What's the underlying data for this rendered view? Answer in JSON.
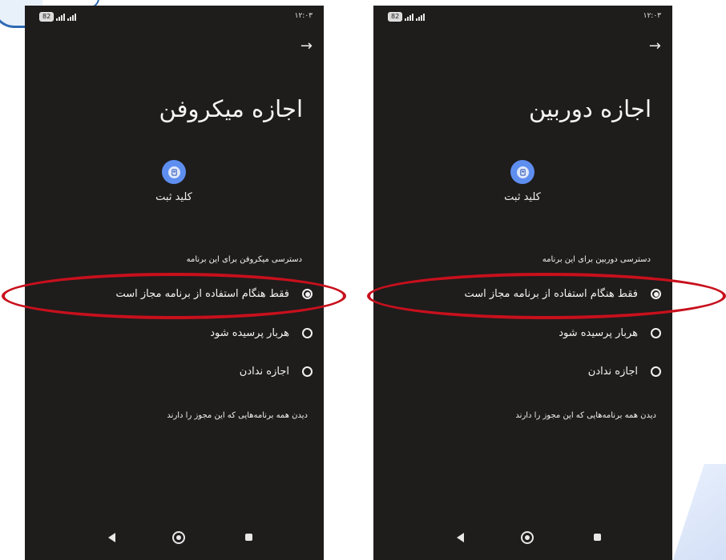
{
  "screens": [
    {
      "statusbar": {
        "battery": "82",
        "time": "۱۲:۰۳"
      },
      "back_arrow": "→",
      "title": "اجازه میکروفن",
      "app_name": "کلید ثبت",
      "access_label": "دسترسی میکروفن برای این برنامه",
      "options": [
        {
          "label": "فقط هنگام استفاده از برنامه مجاز است",
          "selected": true
        },
        {
          "label": "هربار پرسیده شود",
          "selected": false
        },
        {
          "label": "اجازه ندادن",
          "selected": false
        }
      ],
      "see_all": "دیدن همه برنامه‌هایی که این مجوز را دارند"
    },
    {
      "statusbar": {
        "battery": "82",
        "time": "۱۲:۰۳"
      },
      "back_arrow": "→",
      "title": "اجازه دوربین",
      "app_name": "کلید ثبت",
      "access_label": "دسترسی دوربین برای این برنامه",
      "options": [
        {
          "label": "فقط هنگام استفاده از برنامه مجاز است",
          "selected": true
        },
        {
          "label": "هربار پرسیده شود",
          "selected": false
        },
        {
          "label": "اجازه ندادن",
          "selected": false
        }
      ],
      "see_all": "دیدن همه برنامه‌هایی که این مجوز را دارند"
    }
  ],
  "colors": {
    "screen_bg": "#1f1c1c",
    "highlight_ellipse": "#c8101c",
    "app_icon": "#5d8ef0"
  },
  "icons": [
    "battery-icon",
    "signal-icon",
    "arrow-right-icon",
    "app-icon",
    "radio-icon",
    "nav-back-icon",
    "nav-home-icon",
    "nav-recent-icon"
  ]
}
